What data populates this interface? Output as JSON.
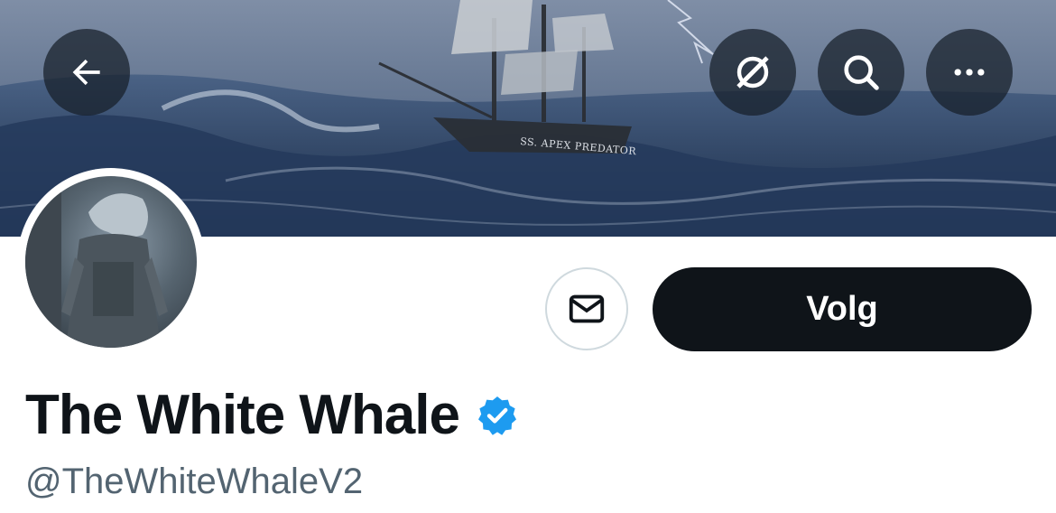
{
  "header": {
    "banner": {
      "ship_name": "SS. APEX PREDATOR"
    },
    "buttons": {
      "back_icon": "arrow-left-icon",
      "grok_icon": "grok-icon",
      "search_icon": "search-icon",
      "more_icon": "more-horizontal-icon"
    }
  },
  "profile": {
    "display_name": "The White Whale",
    "handle": "@TheWhiteWhaleV2",
    "verified": true,
    "verified_color": "#1d9bf0"
  },
  "actions": {
    "message_icon": "mail-icon",
    "follow_label": "Volg"
  },
  "colors": {
    "primary_button_bg": "#0f1419",
    "handle_text": "#536471",
    "name_text": "#0f1419"
  }
}
